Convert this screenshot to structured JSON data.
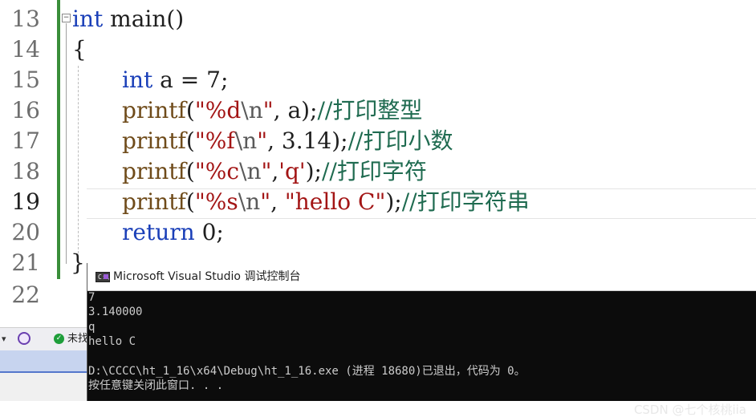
{
  "editor": {
    "line_numbers": [
      "13",
      "14",
      "15",
      "16",
      "17",
      "18",
      "19",
      "20",
      "21",
      "22"
    ],
    "active_line": "19",
    "collapse_glyph": "−",
    "lines": {
      "l13": {
        "kw": "int",
        "rest": " main()"
      },
      "l14": {
        "text": "{"
      },
      "l15": {
        "kw": "int",
        "var": " a = ",
        "num": "7",
        "end": ";"
      },
      "l16": {
        "fn": "printf",
        "p1": "(",
        "str1": "\"%d",
        "esc": "\\n",
        "str2": "\"",
        "args": ", a);",
        "cmt": "//打印整型"
      },
      "l17": {
        "fn": "printf",
        "p1": "(",
        "str1": "\"%f",
        "esc": "\\n",
        "str2": "\"",
        "args": ", 3.14);",
        "cmt": "//打印小数"
      },
      "l18": {
        "fn": "printf",
        "p1": "(",
        "str1": "\"%c",
        "esc": "\\n",
        "str2": "\"",
        "sep": ",",
        "chr": "'q'",
        "args": ");",
        "cmt": "//打印字符"
      },
      "l19": {
        "fn": "printf",
        "p1": "(",
        "str1": "\"%s",
        "esc": "\\n",
        "str2": "\"",
        "sep": ", ",
        "str3": "\"hello C\"",
        "args": ");",
        "cmt": "//打印字符串"
      },
      "l20": {
        "kw": "return",
        "num": " 0",
        "end": ";"
      },
      "l21": {
        "text": "}"
      }
    }
  },
  "statusbar": {
    "dropdown_glyph": "▾",
    "ok_glyph": "✓",
    "issues_text": "未找"
  },
  "console": {
    "title": "Microsoft Visual Studio 调试控制台",
    "icon_prompt": "C:\\",
    "output": [
      "7",
      "3.140000",
      "q",
      "hello C",
      "",
      "D:\\CCCC\\ht_1_16\\x64\\Debug\\ht_1_16.exe (进程 18680)已退出，代码为 0。",
      "按任意键关闭此窗口. . ."
    ]
  },
  "watermark": "CSDN @七个核桃iia"
}
